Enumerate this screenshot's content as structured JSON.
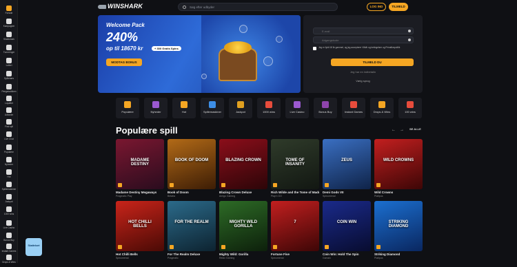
{
  "sidebar": {
    "items": [
      {
        "label": "Forside",
        "icon": "home-icon",
        "active": true
      },
      {
        "label": "Kampagner",
        "icon": "gift-icon"
      },
      {
        "label": "Sharkshark",
        "icon": "shark-icon"
      },
      {
        "label": "Turneringer",
        "icon": "trophy-icon"
      },
      {
        "label": "Lotteri",
        "icon": "ticket-icon"
      },
      {
        "label": "Spillebørs",
        "icon": "bag-icon"
      },
      {
        "label": "Pengebutikken",
        "icon": "shop-icon"
      },
      {
        "label": "Loyalitet",
        "icon": "crown-icon"
      },
      {
        "label": "Udfordre",
        "icon": "target-icon"
      },
      {
        "label": "Find spil",
        "icon": "search-icon"
      },
      {
        "label": "Live Chat",
        "icon": "chat-icon"
      },
      {
        "label": "Populære",
        "icon": "star-icon"
      },
      {
        "label": "Nyheder",
        "icon": "sparkle-icon"
      },
      {
        "label": "Hot",
        "icon": "fire-icon"
      },
      {
        "label": "Spillemaskiner",
        "icon": "slot-icon"
      },
      {
        "label": "Jackpot",
        "icon": "jackpot-icon"
      },
      {
        "label": "1000 wins",
        "icon": "wins-icon"
      },
      {
        "label": "Live Casino",
        "icon": "live-icon"
      },
      {
        "label": "Bonus Buy",
        "icon": "bonus-icon"
      },
      {
        "label": "Instant Games",
        "icon": "instant-icon"
      },
      {
        "label": "Drops & Wins",
        "icon": "drops-icon"
      }
    ]
  },
  "header": {
    "logo_text": "WINSHARK",
    "search_placeholder": "Søg efter udbyder",
    "login_label": "LOG IND",
    "join_label": "TILMELD"
  },
  "banner": {
    "title": "Welcome Pack",
    "percent": "240%",
    "amount": "op til 18670 kr",
    "spins": "+ 300 Gratis Spins",
    "cta": "MODTAG BONUS"
  },
  "login_form": {
    "email_placeholder": "E-mail",
    "password_placeholder": "Adgangskode",
    "checkbox_text": "Jeg er fyldt 18 år gammel, og jeg accepterer Vilkår og betingelser og Privatlivspolitik",
    "submit_label": "TILMELD DU",
    "forgot": "Jeg har en indbetalin",
    "language": "Vælg sprog"
  },
  "categories": [
    {
      "label": "Populære",
      "color": "#f5a623"
    },
    {
      "label": "Nyheder",
      "color": "#9b59d0"
    },
    {
      "label": "Hot",
      "color": "#f5a623"
    },
    {
      "label": "Spillemaskiner",
      "color": "#3d8ee6"
    },
    {
      "label": "Jackpot",
      "color": "#e0a020"
    },
    {
      "label": "1000 wins",
      "color": "#e74c3c"
    },
    {
      "label": "Live Casino",
      "color": "#9b59d0"
    },
    {
      "label": "Bonus Buy",
      "color": "#8e44ad"
    },
    {
      "label": "Instant Games",
      "color": "#e74c3c"
    },
    {
      "label": "Drops & Wins",
      "color": "#f5a623"
    },
    {
      "label": "100 wins",
      "color": "#e74c3c"
    }
  ],
  "section": {
    "title": "Populære spill",
    "see_all": "SE ALLE"
  },
  "games": [
    {
      "name": "Madame Destiny Megaways",
      "provider": "Pragmatic Play",
      "art": "MADAME DESTINY",
      "c1": "#7a1730",
      "c2": "#2a0c1e"
    },
    {
      "name": "Book of Doom",
      "provider": "Belatra",
      "art": "BOOK OF DOOM",
      "c1": "#b26a17",
      "c2": "#3d1d05"
    },
    {
      "name": "Blazing Crown Deluxe",
      "provider": "Amigo Gaming",
      "art": "BLAZING CROWN",
      "c1": "#8b0e1a",
      "c2": "#2c0508"
    },
    {
      "name": "Rich Wilde and the Tome of Madness",
      "provider": "Play'n GO",
      "art": "TOME OF INSANITY",
      "c1": "#2f3b2a",
      "c2": "#121712"
    },
    {
      "name": "Demi Gods VII",
      "provider": "Spinomenal",
      "art": "ZEUS",
      "c1": "#3a6fc2",
      "c2": "#0f2348"
    },
    {
      "name": "Wild Crowns",
      "provider": "Platipus",
      "art": "WILD CROWNS",
      "c1": "#c21f1f",
      "c2": "#3d0606"
    },
    {
      "name": "Hot Chilli Bells",
      "provider": "Spinomenal",
      "art": "HOT CHILLI BELLS",
      "c1": "#c9241a",
      "c2": "#4a0a05"
    },
    {
      "name": "For The Realm Deluxe",
      "provider": "Pragmatic",
      "art": "FOR THE REALM",
      "c1": "#2b6a8a",
      "c2": "#0d2330"
    },
    {
      "name": "Mighty Wild: Gorilla",
      "provider": "Relax Gaming",
      "art": "MIGHTY WILD GORILLA",
      "c1": "#2d6b26",
      "c2": "#0d200b"
    },
    {
      "name": "Fortune Five",
      "provider": "Spinomenal",
      "art": "7",
      "c1": "#c21f1f",
      "c2": "#3d0606"
    },
    {
      "name": "Coin Win: Hold The Spin",
      "provider": "Gamzix",
      "art": "COIN WIN",
      "c1": "#1a2a8a",
      "c2": "#080c30"
    },
    {
      "name": "Striking Diamond",
      "provider": "Platipus",
      "art": "STRIKING DIAMOND",
      "c1": "#1b6fd0",
      "c2": "#0a2760"
    }
  ],
  "chat": {
    "label": "Skattekort"
  }
}
